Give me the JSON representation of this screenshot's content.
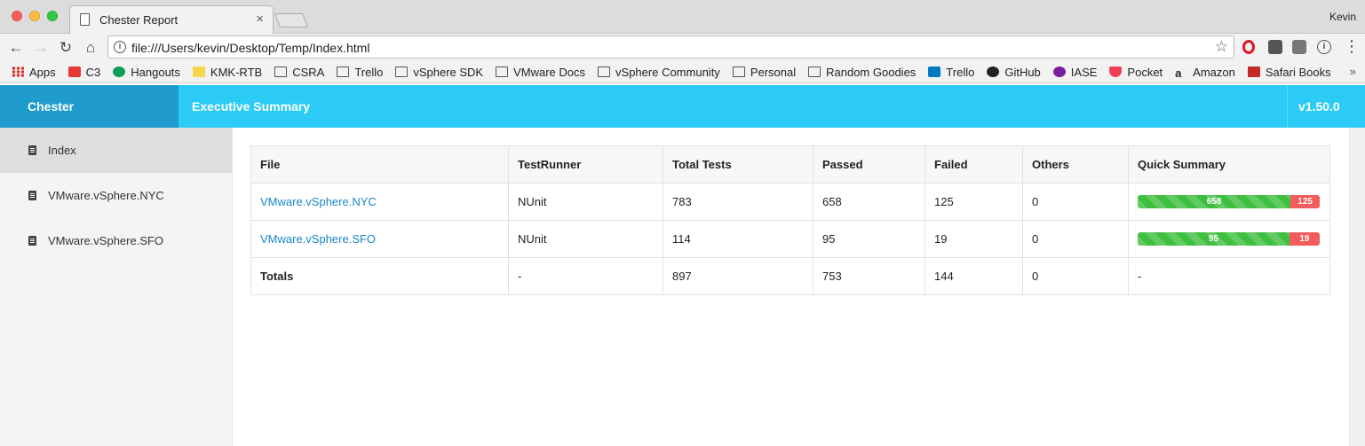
{
  "browser": {
    "tab_title": "Chester Report",
    "profile_name": "Kevin",
    "url": "file:///Users/kevin/Desktop/Temp/Index.html",
    "bookmarks": [
      {
        "label": "Apps",
        "icon": "apps-icon"
      },
      {
        "label": "C3",
        "icon": "c3-icon"
      },
      {
        "label": "Hangouts",
        "icon": "hangouts-icon"
      },
      {
        "label": "KMK-RTB",
        "icon": "bookmark-icon"
      },
      {
        "label": "CSRA",
        "icon": "folder-icon"
      },
      {
        "label": "Trello",
        "icon": "folder-icon"
      },
      {
        "label": "vSphere SDK",
        "icon": "folder-icon"
      },
      {
        "label": "VMware Docs",
        "icon": "folder-icon"
      },
      {
        "label": "vSphere Community",
        "icon": "folder-icon"
      },
      {
        "label": "Personal",
        "icon": "folder-icon"
      },
      {
        "label": "Random Goodies",
        "icon": "folder-icon"
      },
      {
        "label": "Trello",
        "icon": "trello-icon"
      },
      {
        "label": "GitHub",
        "icon": "github-icon"
      },
      {
        "label": "IASE",
        "icon": "iase-icon"
      },
      {
        "label": "Pocket",
        "icon": "pocket-icon"
      },
      {
        "label": "Amazon",
        "icon": "amazon-icon"
      },
      {
        "label": "Safari Books",
        "icon": "safari-books-icon"
      }
    ]
  },
  "header": {
    "brand": "Chester",
    "title": "Executive Summary",
    "version": "v1.50.0"
  },
  "sidebar": {
    "items": [
      {
        "label": "Index",
        "active": true
      },
      {
        "label": "VMware.vSphere.NYC",
        "active": false
      },
      {
        "label": "VMware.vSphere.SFO",
        "active": false
      }
    ]
  },
  "table": {
    "headers": [
      "File",
      "TestRunner",
      "Total Tests",
      "Passed",
      "Failed",
      "Others",
      "Quick Summary"
    ],
    "rows": [
      {
        "file": "VMware.vSphere.NYC",
        "runner": "NUnit",
        "total": "783",
        "passed": "658",
        "failed": "125",
        "others": "0",
        "summary": {
          "passed": 658,
          "failed": 125,
          "passed_label": "658",
          "failed_label": "125"
        }
      },
      {
        "file": "VMware.vSphere.SFO",
        "runner": "NUnit",
        "total": "114",
        "passed": "95",
        "failed": "19",
        "others": "0",
        "summary": {
          "passed": 95,
          "failed": 19,
          "passed_label": "95",
          "failed_label": "19"
        }
      }
    ],
    "totals": {
      "label": "Totals",
      "runner": "-",
      "total": "897",
      "passed": "753",
      "failed": "144",
      "others": "0",
      "summary": "-"
    }
  },
  "colors": {
    "header_bg": "#2bcbf6",
    "brand_bg": "#1f9ccd",
    "link": "#1a86c8",
    "pass": "#3fbf3f",
    "fail": "#f25c5c"
  }
}
